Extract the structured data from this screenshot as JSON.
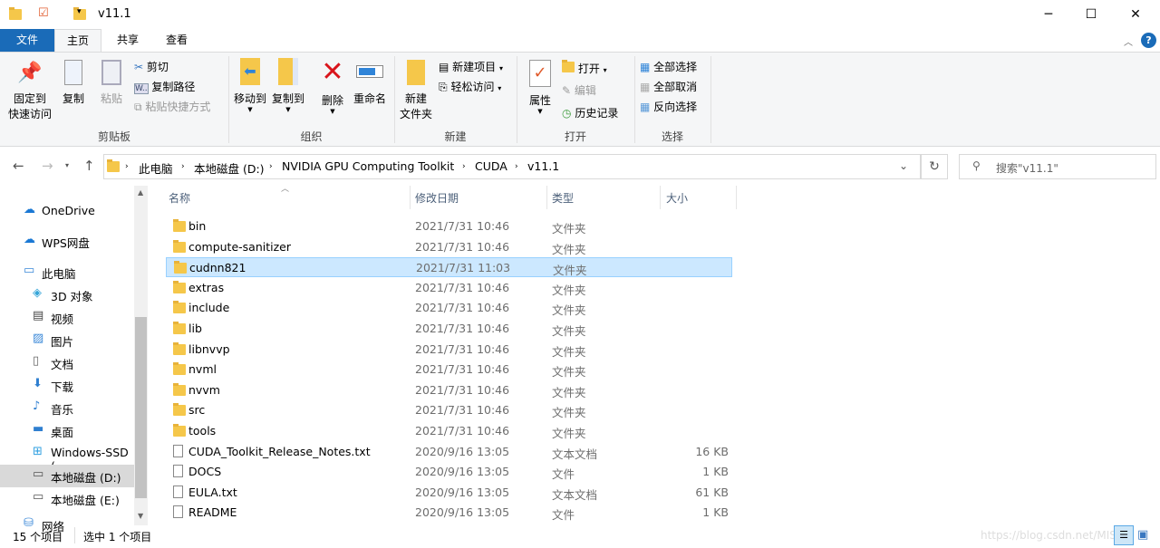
{
  "window": {
    "title": "v11.1",
    "minimize": "─",
    "maximize": "☐",
    "close": "✕"
  },
  "tabs": {
    "file": "文件",
    "home": "主页",
    "share": "共享",
    "view": "查看"
  },
  "ribbon": {
    "clipboard": {
      "label": "剪贴板",
      "pin": [
        "固定到",
        "快速访问"
      ],
      "copy": "复制",
      "paste": "粘贴",
      "cut": "剪切",
      "copy_path": "复制路径",
      "paste_shortcut": "粘贴快捷方式"
    },
    "organize": {
      "label": "组织",
      "move_to": "移动到",
      "copy_to": "复制到",
      "delete": "删除",
      "rename": "重命名"
    },
    "new": {
      "label": "新建",
      "new_folder": [
        "新建",
        "文件夹"
      ],
      "new_item": "新建项目",
      "easy_access": "轻松访问"
    },
    "open": {
      "label": "打开",
      "properties": "属性",
      "open": "打开",
      "edit": "编辑",
      "history": "历史记录"
    },
    "select": {
      "label": "选择",
      "select_all": "全部选择",
      "select_none": "全部取消",
      "invert": "反向选择"
    }
  },
  "address": {
    "crumbs": [
      "此电脑",
      "本地磁盘 (D:)",
      "NVIDIA GPU Computing Toolkit",
      "CUDA",
      "v11.1"
    ],
    "search_placeholder": "搜索\"v11.1\""
  },
  "sidebar": [
    "OneDrive",
    "WPS网盘",
    "此电脑",
    "3D 对象",
    "视频",
    "图片",
    "文档",
    "下载",
    "音乐",
    "桌面",
    "Windows-SSD (",
    "本地磁盘 (D:)",
    "本地磁盘 (E:)",
    "网络"
  ],
  "columns": {
    "name": "名称",
    "date": "修改日期",
    "type": "类型",
    "size": "大小"
  },
  "files": [
    {
      "name": "bin",
      "date": "2021/7/31 10:46",
      "type": "文件夹",
      "size": "",
      "kind": "folder"
    },
    {
      "name": "compute-sanitizer",
      "date": "2021/7/31 10:46",
      "type": "文件夹",
      "size": "",
      "kind": "folder"
    },
    {
      "name": "cudnn821",
      "date": "2021/7/31 11:03",
      "type": "文件夹",
      "size": "",
      "kind": "folder",
      "selected": true
    },
    {
      "name": "extras",
      "date": "2021/7/31 10:46",
      "type": "文件夹",
      "size": "",
      "kind": "folder"
    },
    {
      "name": "include",
      "date": "2021/7/31 10:46",
      "type": "文件夹",
      "size": "",
      "kind": "folder"
    },
    {
      "name": "lib",
      "date": "2021/7/31 10:46",
      "type": "文件夹",
      "size": "",
      "kind": "folder"
    },
    {
      "name": "libnvvp",
      "date": "2021/7/31 10:46",
      "type": "文件夹",
      "size": "",
      "kind": "folder"
    },
    {
      "name": "nvml",
      "date": "2021/7/31 10:46",
      "type": "文件夹",
      "size": "",
      "kind": "folder"
    },
    {
      "name": "nvvm",
      "date": "2021/7/31 10:46",
      "type": "文件夹",
      "size": "",
      "kind": "folder"
    },
    {
      "name": "src",
      "date": "2021/7/31 10:46",
      "type": "文件夹",
      "size": "",
      "kind": "folder"
    },
    {
      "name": "tools",
      "date": "2021/7/31 10:46",
      "type": "文件夹",
      "size": "",
      "kind": "folder"
    },
    {
      "name": "CUDA_Toolkit_Release_Notes.txt",
      "date": "2020/9/16 13:05",
      "type": "文本文档",
      "size": "16 KB",
      "kind": "file"
    },
    {
      "name": "DOCS",
      "date": "2020/9/16 13:05",
      "type": "文件",
      "size": "1 KB",
      "kind": "file"
    },
    {
      "name": "EULA.txt",
      "date": "2020/9/16 13:05",
      "type": "文本文档",
      "size": "61 KB",
      "kind": "file"
    },
    {
      "name": "README",
      "date": "2020/9/16 13:05",
      "type": "文件",
      "size": "1 KB",
      "kind": "file"
    }
  ],
  "status": {
    "count": "15 个项目",
    "selected": "选中 1 个项目"
  },
  "watermark": "https://blog.csdn.net/MISS"
}
